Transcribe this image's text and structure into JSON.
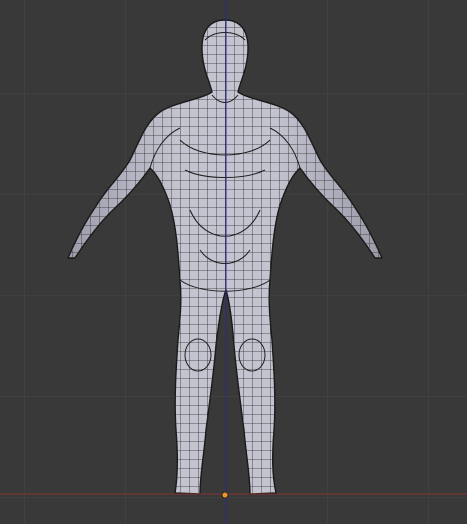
{
  "viewport": {
    "background_color": "#393939",
    "grid_color": "#474747",
    "x_axis_color": "#8a3131",
    "z_axis_color": "#2a2a8a",
    "mesh_fill_color": "#b9b9c6",
    "wireframe_color": "#1a1a1a",
    "origin_color": "#f0932b"
  },
  "mesh": {
    "type": "humanoid-base-mesh",
    "pose": "A-pose",
    "view": "front-orthographic",
    "display": "solid-with-wireframe"
  }
}
